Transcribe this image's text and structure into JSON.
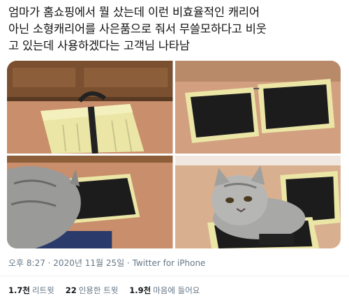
{
  "tweet": {
    "lines": [
      "엄마가 홈쇼핑에서 뭘 샀는데 이런 비효율적인 캐리어",
      "아닌 소형캐리어를 사은품으로 줘서 무쓸모하다고 비웃",
      "고 있는데 사용하겠다는 고객님 나타남"
    ]
  },
  "media": {
    "photos": [
      {
        "label": "yellow-suitcase-closed"
      },
      {
        "label": "yellow-suitcase-open"
      },
      {
        "label": "cat-peeking-into-suitcase"
      },
      {
        "label": "cat-sitting-in-suitcase"
      }
    ]
  },
  "meta": {
    "time": "오후 8:27",
    "sep1": " · ",
    "date": "2020년 11월 25일",
    "sep2": " · ",
    "source": "Twitter for iPhone"
  },
  "stats": {
    "retweets_count": "1.7천",
    "retweets_label": "리트윗",
    "quotes_count": "22",
    "quotes_label": "인용한 트윗",
    "likes_count": "1.9천",
    "likes_label": "마음에 들어요"
  },
  "colors": {
    "suitcase": "#ebe6a6",
    "floor": "#c98e6b",
    "cat": "#9a9a98"
  }
}
